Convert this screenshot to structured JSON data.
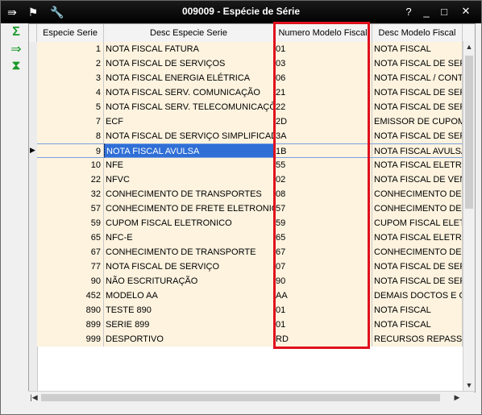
{
  "window": {
    "title": "009009 - Espécie de Série",
    "controls": {
      "help": "?",
      "minimize": "_",
      "maximize": "□",
      "close": "✕"
    }
  },
  "toolbar": {
    "menu_icon": "⇛",
    "traffic_icon": "⚑",
    "wrench_icon": "🔧"
  },
  "side_actions": {
    "sum_label": "Σ",
    "export_label": "⇒",
    "filter_label": "⧗"
  },
  "grid": {
    "columns": [
      "Especie Serie",
      "Desc Especie Serie",
      "Numero Modelo Fiscal",
      "Desc Modelo Fiscal"
    ],
    "rows": [
      {
        "especie": "1",
        "desc": "NOTA FISCAL FATURA",
        "modelo": "01",
        "desc_modelo": "NOTA FISCAL"
      },
      {
        "especie": "2",
        "desc": "NOTA FISCAL DE SERVIÇOS",
        "modelo": "03",
        "desc_modelo": "NOTA FISCAL DE SERV"
      },
      {
        "especie": "3",
        "desc": "NOTA FISCAL ENERGIA ELÉTRICA",
        "modelo": "06",
        "desc_modelo": "NOTA FISCAL / CONTA"
      },
      {
        "especie": "4",
        "desc": "NOTA FISCAL SERV. COMUNICAÇÃO",
        "modelo": "21",
        "desc_modelo": "NOTA FISCAL DE SERV"
      },
      {
        "especie": "5",
        "desc": "NOTA FISCAL SERV. TELECOMUNICAÇÕES",
        "modelo": "22",
        "desc_modelo": "NOTA FISCAL DE SERV"
      },
      {
        "especie": "7",
        "desc": "ECF",
        "modelo": "2D",
        "desc_modelo": "EMISSOR DE CUPOM F"
      },
      {
        "especie": "8",
        "desc": "NOTA FISCAL DE SERVIÇO SIMPLIFICADA",
        "modelo": "3A",
        "desc_modelo": "NOTA FISCAL DE SERV"
      },
      {
        "especie": "9",
        "desc": "NOTA FISCAL AVULSA",
        "modelo": "1B",
        "desc_modelo": "NOTA FISCAL AVULSA"
      },
      {
        "especie": "10",
        "desc": "NFE",
        "modelo": "55",
        "desc_modelo": "NOTA FISCAL ELETRO"
      },
      {
        "especie": "22",
        "desc": "NFVC",
        "modelo": "02",
        "desc_modelo": "NOTA FISCAL DE VEND"
      },
      {
        "especie": "32",
        "desc": "CONHECIMENTO DE TRANSPORTES",
        "modelo": "08",
        "desc_modelo": "CONHECIMENTO DE T"
      },
      {
        "especie": "57",
        "desc": "CONHECIMENTO DE FRETE ELETRONICO",
        "modelo": "57",
        "desc_modelo": "CONHECIMENTO DE T"
      },
      {
        "especie": "59",
        "desc": "CUPOM FISCAL ELETRONICO",
        "modelo": "59",
        "desc_modelo": "CUPOM FISCAL ELETR"
      },
      {
        "especie": "65",
        "desc": "NFC-E",
        "modelo": "65",
        "desc_modelo": "NOTA FISCAL ELETRÔ"
      },
      {
        "especie": "67",
        "desc": "CONHECIMENTO DE TRANSPORTE",
        "modelo": "67",
        "desc_modelo": "CONHECIMENTO DE T"
      },
      {
        "especie": "77",
        "desc": "NOTA FISCAL DE SERVIÇO",
        "modelo": "07",
        "desc_modelo": "NOTA FISCAL DE SERV"
      },
      {
        "especie": "90",
        "desc": "NÃO ESCRITURAÇÃO",
        "modelo": "90",
        "desc_modelo": "NOTA FISCAL DE SERV"
      },
      {
        "especie": "452",
        "desc": "MODELO AA",
        "modelo": "AA",
        "desc_modelo": "DEMAIS DOCTOS E OF"
      },
      {
        "especie": "890",
        "desc": "TESTE 890",
        "modelo": "01",
        "desc_modelo": "NOTA FISCAL"
      },
      {
        "especie": "899",
        "desc": "SERIE 899",
        "modelo": "01",
        "desc_modelo": "NOTA FISCAL"
      },
      {
        "especie": "999",
        "desc": "DESPORTIVO",
        "modelo": "RD",
        "desc_modelo": "RECURSOS REPASSE D"
      }
    ],
    "selected_index": 7
  },
  "scroll": {
    "up": "▲",
    "down": "▼",
    "left": "◀",
    "right": "▶",
    "first": "|◀"
  },
  "colors": {
    "row_bg": "#fdf3df",
    "selection": "#2f6fd6",
    "highlight_box": "#e0101d"
  }
}
